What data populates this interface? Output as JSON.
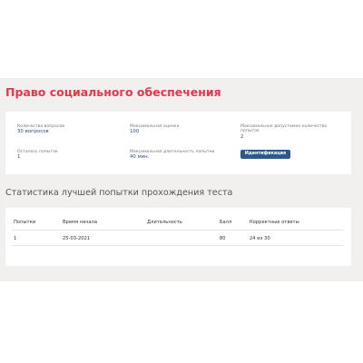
{
  "title": "Право социального обеспечения",
  "info": {
    "questions_label": "Количество вопросов",
    "questions_value": "30 вопросов",
    "max_score_label": "Максимальная оценка",
    "max_score_value": "100",
    "max_attempts_label": "Максимальное допустимое количество попыток",
    "max_attempts_value": "2",
    "remaining_label": "Осталось попыток",
    "remaining_value": "1",
    "max_duration_label": "Максимальная длительность попытки",
    "max_duration_value": "40 мин.",
    "identify_button": "Идентификация"
  },
  "stats": {
    "title": "Статистика лучшей попытки прохождения теста",
    "columns": [
      "Попытки",
      "Время начала",
      "Длительность",
      "Балл",
      "Корректные ответы"
    ],
    "rows": [
      [
        "1",
        "25-03-2021",
        "",
        "80",
        "24 из 30"
      ]
    ]
  },
  "colors": {
    "title": "#e5374a",
    "value": "#2b4f86",
    "button": "#2d5a8c",
    "background": "#f1f0ee"
  }
}
